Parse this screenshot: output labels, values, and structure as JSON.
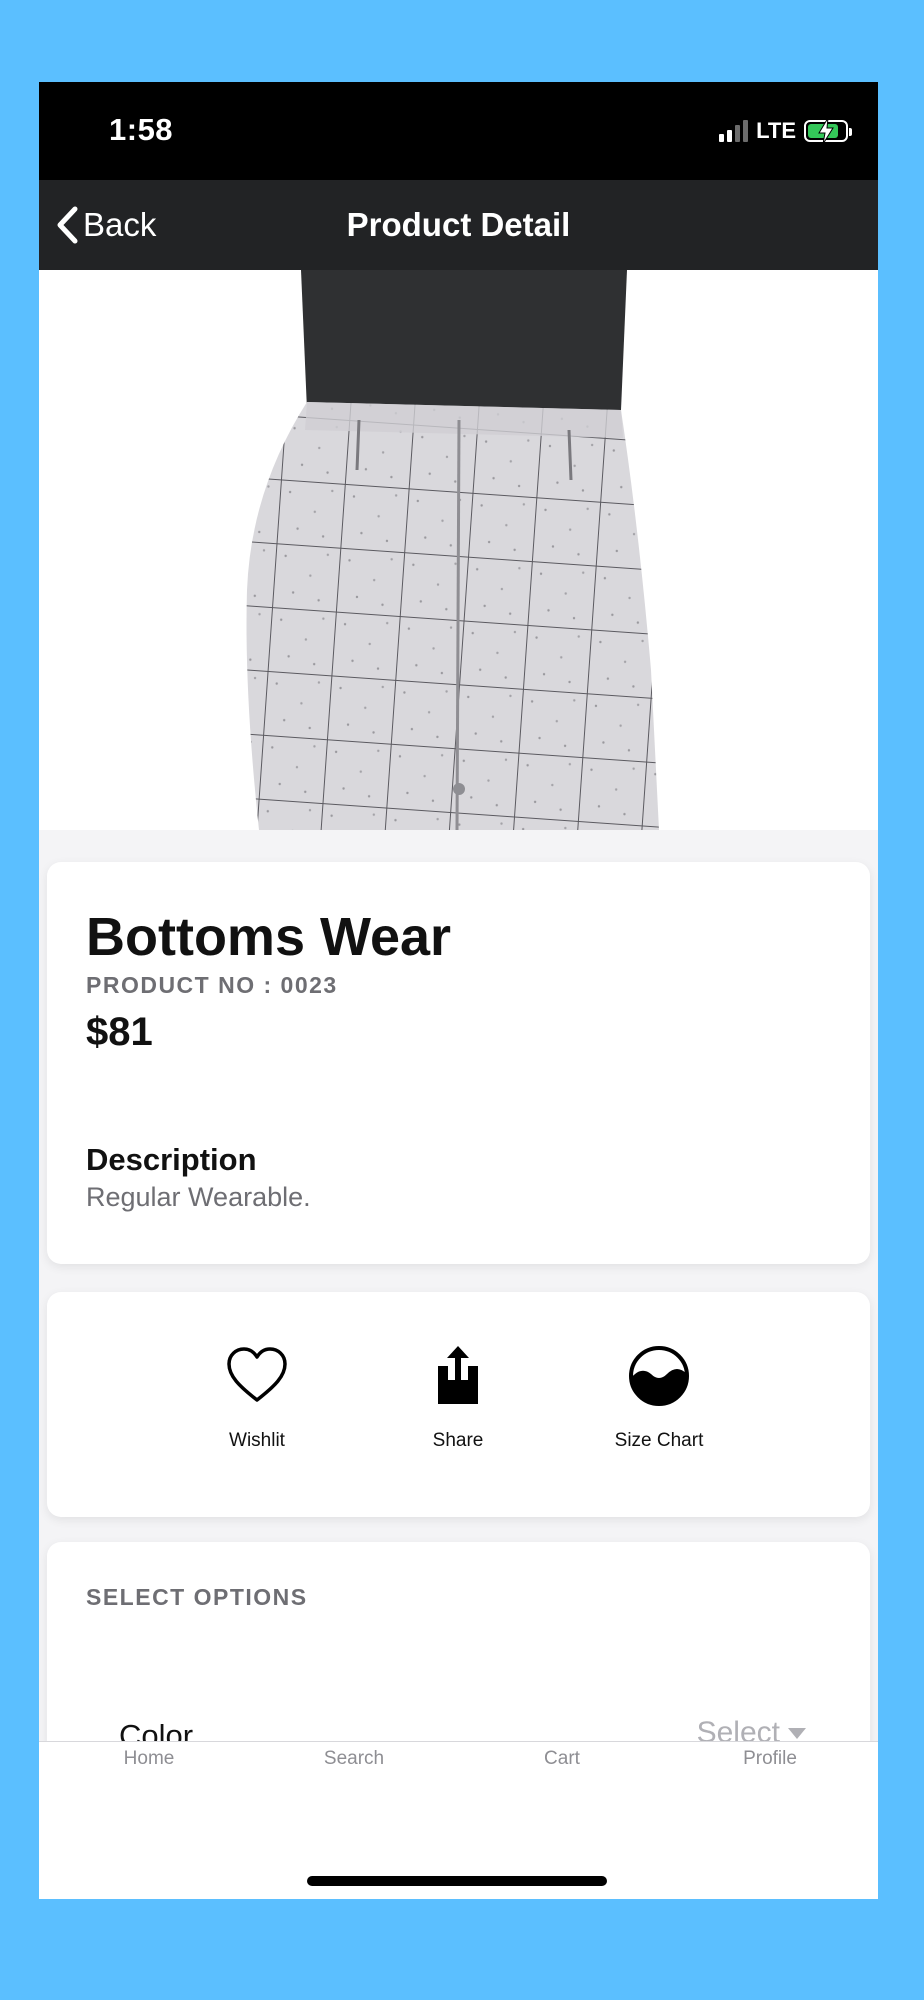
{
  "status_bar": {
    "time": "1:58",
    "network": "LTE"
  },
  "nav": {
    "back_label": "Back",
    "title": "Product Detail"
  },
  "product": {
    "name": "Bottoms Wear",
    "number": "PRODUCT NO : 0023",
    "price": "$81",
    "description_heading": "Description",
    "description": "Regular Wearable."
  },
  "actions": [
    {
      "label": "Wishlit",
      "icon": "heart-icon"
    },
    {
      "label": "Share",
      "icon": "share-icon"
    },
    {
      "label": "Size Chart",
      "icon": "size-chart-icon"
    }
  ],
  "options": {
    "heading": "SELECT OPTIONS",
    "color_label": "Color",
    "color_value": "Select"
  },
  "tabs": [
    {
      "label": "Home"
    },
    {
      "label": "Search"
    },
    {
      "label": "Cart"
    },
    {
      "label": "Profile"
    }
  ],
  "colors": {
    "background": "#5BBFFF",
    "nav_bar": "#222325",
    "status_bar": "#000000",
    "battery": "#34c759"
  }
}
